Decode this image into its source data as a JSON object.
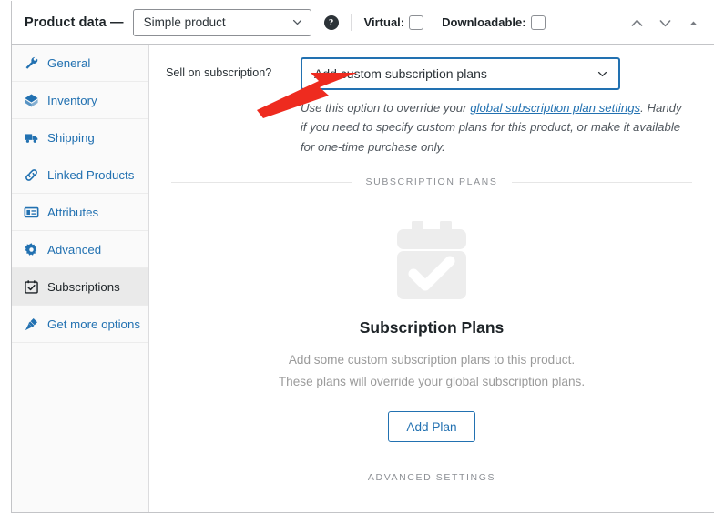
{
  "header": {
    "title": "Product data —",
    "product_type": "Simple product",
    "help_icon": "help-circle-icon",
    "virtual_label": "Virtual:",
    "virtual_checked": false,
    "downloadable_label": "Downloadable:",
    "downloadable_checked": false,
    "actions": [
      {
        "name": "move-up-icon",
        "glyph": "chevron-up"
      },
      {
        "name": "move-down-icon",
        "glyph": "chevron-down"
      },
      {
        "name": "toggle-panel-icon",
        "glyph": "triangle-up"
      }
    ]
  },
  "sidebar": {
    "items": [
      {
        "label": "General",
        "icon": "wrench-icon",
        "active": false
      },
      {
        "label": "Inventory",
        "icon": "box-icon",
        "active": false
      },
      {
        "label": "Shipping",
        "icon": "truck-icon",
        "active": false
      },
      {
        "label": "Linked Products",
        "icon": "link-icon",
        "active": false
      },
      {
        "label": "Attributes",
        "icon": "form-card-icon",
        "active": false
      },
      {
        "label": "Advanced",
        "icon": "gear-icon",
        "active": false
      },
      {
        "label": "Subscriptions",
        "icon": "calendar-check-icon",
        "active": true
      },
      {
        "label": "Get more options",
        "icon": "plug-icon",
        "active": false
      }
    ]
  },
  "main": {
    "field": {
      "label": "Sell on subscription?",
      "selected_option": "Add custom subscription plans",
      "description_part1": "Use this option to override your ",
      "description_link": "global subscription plan settings",
      "description_part2": ". Handy if you need to specify custom plans for this product, or make it available for one-time purchase only."
    },
    "section_plans_label": "SUBSCRIPTION PLANS",
    "empty_state": {
      "icon": "calendar-check-illustration",
      "title": "Subscription Plans",
      "line1": "Add some custom subscription plans to this product.",
      "line2": "These plans will override your global subscription plans.",
      "button_label": "Add Plan"
    },
    "section_advanced_label": "ADVANCED SETTINGS"
  },
  "annotation": {
    "arrow": "red-pointer-arrow",
    "color": "#ee2b1f"
  },
  "colors": {
    "link": "#2271b1",
    "accent": "#2271b1",
    "text": "#1d2327",
    "muted": "#9b9b9b",
    "border": "#c3c4c7",
    "sidebar_bg": "#fafafa",
    "active_tab_bg": "#eaeaea"
  }
}
